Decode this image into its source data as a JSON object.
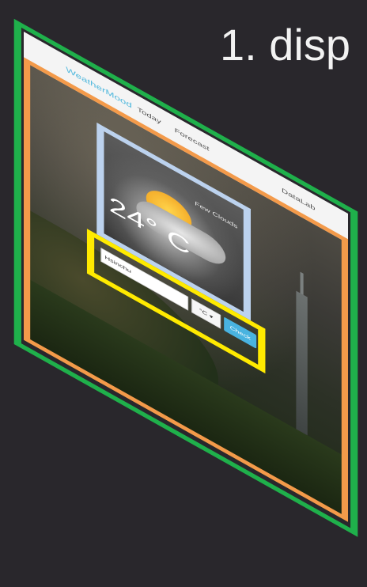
{
  "slide": {
    "title": "1. disp"
  },
  "app": {
    "brand": "WeatherMood",
    "nav": {
      "today": "Today",
      "forecast": "Forecast",
      "datalab": "DataLab"
    }
  },
  "weather": {
    "condition": "Few Clouds",
    "temperature": "24° C",
    "icon": "sun-behind-cloud-icon"
  },
  "search": {
    "city_value": "Hsinchu",
    "unit_selected": "°C ▾",
    "check_label": "Check"
  },
  "colors": {
    "outline_green": "#1fb04b",
    "outline_orange": "#f39a4a",
    "outline_blue": "#bcd2ee",
    "outline_yellow": "#ffea00",
    "brand": "#4fb8dd",
    "check_button": "#49b3e0"
  }
}
